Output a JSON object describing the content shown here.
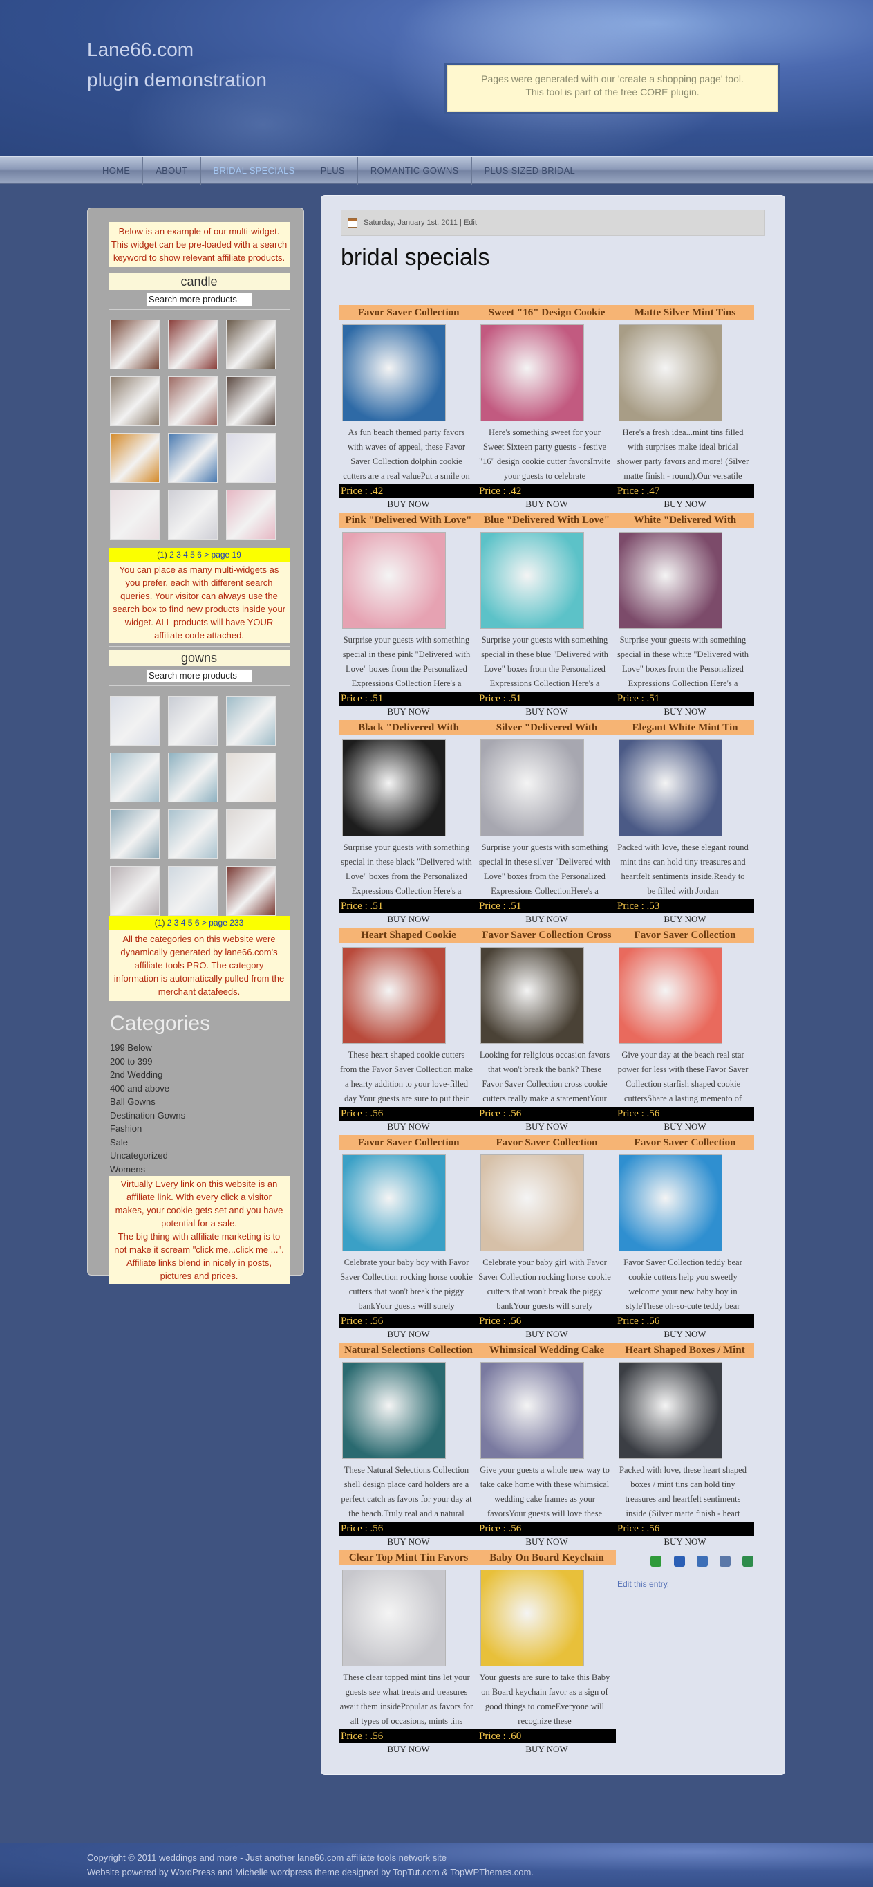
{
  "header": {
    "title_line1": "Lane66.com",
    "title_line2": "plugin demonstration",
    "notice_line1": "Pages were generated with our 'create a shopping page' tool.",
    "notice_line2": "This tool is part of the free CORE plugin."
  },
  "nav": {
    "items": [
      "HOME",
      "ABOUT",
      "BRIDAL SPECIALS",
      "PLUS",
      "ROMANTIC GOWNS",
      "PLUS SIZED BRIDAL"
    ],
    "active": "BRIDAL SPECIALS"
  },
  "sidebar": {
    "widget_intro": "Below is an example of our multi-widget. This widget can be pre-loaded with a search keyword to show relevant affiliate products.",
    "keyword1": "candle",
    "search_placeholder": "Search more products",
    "pager1_current": "1",
    "pager1_pages": "2 3 4 5 6",
    "pager1_next": "> page 19",
    "widget_text2": "You can place as many multi-widgets as you prefer, each with different search queries. Your visitor can always use the search box to find new products inside your widget. ALL products will have YOUR affiliate code attached.",
    "keyword2": "gowns",
    "pager2_current": "1",
    "pager2_pages": "2 3 4 5 6",
    "pager2_next": "> page 233",
    "widget_text3": "All the categories on this website were dynamically generated by lane66.com's affiliate tools PRO. The category information is automatically pulled from the merchant datafeeds.",
    "categories_title": "Categories",
    "categories": [
      "199 Below",
      "200 to 399",
      "2nd Wedding",
      "400 and above",
      "Ball Gowns",
      "Destination Gowns",
      "Fashion",
      "Sale",
      "Uncategorized",
      "Womens"
    ],
    "affiliate_text1": "Virtually Every link on this website is an affiliate link. With every click a visitor makes, your cookie gets set and you have potential for a sale.",
    "affiliate_text2": "The big thing with affiliate marketing is to not make it scream \"click me...click me ...\". Affiliate links blend in nicely in posts, pictures and prices."
  },
  "post": {
    "date": "Saturday, January 1st, 2011",
    "edit_label": "Edit",
    "title": "bridal specials",
    "edit_entry": "Edit this entry."
  },
  "products": [
    {
      "title": "Favor Saver Collection",
      "desc": "As fun beach themed party favors with waves of appeal, these Favor Saver Collection dolphin cookie cutters are a real valuePut a smile on",
      "price": "Price : .42"
    },
    {
      "title": "Sweet \"16\" Design Cookie",
      "desc": "Here's something sweet for your Sweet Sixteen party guests - festive \"16\" design cookie cutter favorsInvite your guests to celebrate",
      "price": "Price : .42"
    },
    {
      "title": "Matte Silver Mint Tins",
      "desc": "Here's a fresh idea...mint tins filled with surprises make ideal bridal shower party favors and more! (Silver matte finish - round).Our versatile",
      "price": "Price : .47"
    },
    {
      "title": "Pink \"Delivered With Love\"",
      "desc": "Surprise your guests with something special in these pink \"Delivered with Love\" boxes from the Personalized Expressions Collection Here's a",
      "price": "Price : .51"
    },
    {
      "title": "Blue \"Delivered With Love\"",
      "desc": "Surprise your guests with something special in these blue \"Delivered with Love\" boxes from the Personalized Expressions Collection Here's a",
      "price": "Price : .51"
    },
    {
      "title": "White \"Delivered With",
      "desc": "Surprise your guests with something special in these white \"Delivered with Love\" boxes from the Personalized Expressions Collection Here's a",
      "price": "Price : .51"
    },
    {
      "title": "Black \"Delivered With",
      "desc": "Surprise your guests with something special in these black \"Delivered with Love\" boxes from the Personalized Expressions Collection Here's a",
      "price": "Price : .51"
    },
    {
      "title": "Silver \"Delivered With",
      "desc": "Surprise your guests with something special in these silver \"Delivered with Love\" boxes from the Personalized Expressions CollectionHere's a",
      "price": "Price : .51"
    },
    {
      "title": "Elegant White Mint Tin",
      "desc": "Packed with love, these elegant round mint tins can hold tiny treasures and heartfelt sentiments inside.Ready to be filled with Jordan",
      "price": "Price : .53"
    },
    {
      "title": "Heart Shaped Cookie",
      "desc": "These heart shaped cookie cutters from the Favor Saver Collection make a hearty addition to your love-filled day Your guests are sure to put their",
      "price": "Price : .56"
    },
    {
      "title": "Favor Saver Collection Cross",
      "desc": "Looking for religious occasion favors that won't break the bank? These Favor Saver Collection cross cookie cutters really make a statementYour",
      "price": "Price : .56"
    },
    {
      "title": "Favor Saver Collection",
      "desc": "Give your day at the beach real star power for less with these Favor Saver Collection starfish shaped cookie cuttersShare a lasting memento of",
      "price": "Price : .56"
    },
    {
      "title": "Favor Saver Collection",
      "desc": "Celebrate your baby boy with Favor Saver Collection rocking horse cookie cutters that won't break the piggy bankYour guests will surely",
      "price": "Price : .56"
    },
    {
      "title": "Favor Saver Collection",
      "desc": "Celebrate your baby girl with Favor Saver Collection rocking horse cookie cutters that won't break the piggy bankYour guests will surely",
      "price": "Price : .56"
    },
    {
      "title": "Favor Saver Collection",
      "desc": "Favor Saver Collection teddy bear cookie cutters help you sweetly welcome your new baby boy in styleThese oh-so-cute teddy bear",
      "price": "Price : .56"
    },
    {
      "title": "Natural Selections Collection",
      "desc": "These Natural Selections Collection shell design place card holders are a perfect catch as favors for your day at the beach.Truly real and a natural",
      "price": "Price : .56"
    },
    {
      "title": "Whimsical Wedding Cake",
      "desc": "Give your guests a whole new way to take cake home with these whimsical wedding cake frames as your favorsYour guests will love these",
      "price": "Price : .56"
    },
    {
      "title": "Heart Shaped Boxes / Mint",
      "desc": "Packed with love, these heart shaped boxes / mint tins can hold tiny treasures and heartfelt sentiments inside (Silver matte finish - heart",
      "price": "Price : .56"
    },
    {
      "title": "Clear Top Mint Tin Favors",
      "desc": "These clear topped mint tins let your guests see what treats and treasures await them insidePopular as favors for all types of occasions, mints tins",
      "price": "Price : .56"
    },
    {
      "title": "Baby On Board Keychain",
      "desc": "Your guests are sure to take this Baby on Board keychain favor as a sign of good things to comeEveryone will recognize these",
      "price": "Price : .60"
    }
  ],
  "buy_label": "BUY NOW",
  "footer": {
    "line1": "Copyright © 2011 weddings and more - Just another lane66.com affiliate tools network site",
    "line2": "Website powered by WordPress and Michelle wordpress theme designed by TopTut.com & TopWPThemes.com."
  },
  "colors": {
    "background": "#3f5380",
    "product_title_bg": "#f6b474",
    "price_bg": "#000000",
    "price_text": "#f4c64a",
    "widget_text": "#b32a10",
    "pager_bg": "#fbff00"
  },
  "icons": [
    "calendar-icon",
    "share-icon-1",
    "share-icon-2",
    "share-icon-3",
    "share-icon-4",
    "share-icon-5"
  ]
}
